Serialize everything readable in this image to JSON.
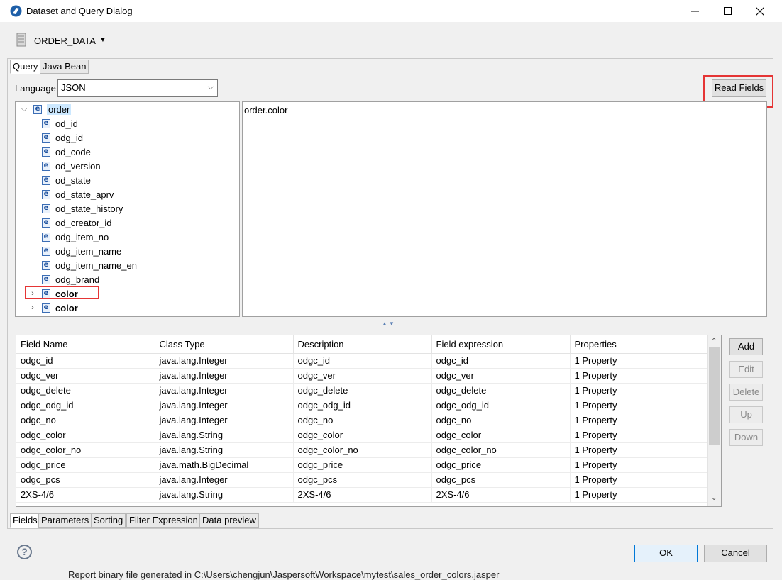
{
  "window": {
    "title": "Dataset and Query Dialog",
    "minimize_icon": "minimize-icon",
    "maximize_icon": "maximize-icon",
    "close_icon": "close-icon"
  },
  "dataset": {
    "name": "ORDER_DATA",
    "icon": "database-icon"
  },
  "top_tabs": [
    {
      "label": "Query",
      "active": true
    },
    {
      "label": "Java Bean",
      "active": false
    }
  ],
  "language": {
    "label": "Language",
    "value": "JSON"
  },
  "read_fields_label": "Read Fields",
  "tree": {
    "root": "order",
    "children": [
      "od_id",
      "odg_id",
      "od_code",
      "od_version",
      "od_state",
      "od_state_aprv",
      "od_state_history",
      "od_creator_id",
      "odg_item_no",
      "odg_item_name",
      "odg_item_name_en",
      "odg_brand"
    ],
    "collapsed": [
      "color",
      "color"
    ]
  },
  "expression": "order.color",
  "table": {
    "columns": [
      "Field Name",
      "Class Type",
      "Description",
      "Field expression",
      "Properties"
    ],
    "rows": [
      [
        "odgc_id",
        "java.lang.Integer",
        "odgc_id",
        "odgc_id",
        "1 Property"
      ],
      [
        "odgc_ver",
        "java.lang.Integer",
        "odgc_ver",
        "odgc_ver",
        "1 Property"
      ],
      [
        "odgc_delete",
        "java.lang.Integer",
        "odgc_delete",
        "odgc_delete",
        "1 Property"
      ],
      [
        "odgc_odg_id",
        "java.lang.Integer",
        "odgc_odg_id",
        "odgc_odg_id",
        "1 Property"
      ],
      [
        "odgc_no",
        "java.lang.Integer",
        "odgc_no",
        "odgc_no",
        "1 Property"
      ],
      [
        "odgc_color",
        "java.lang.String",
        "odgc_color",
        "odgc_color",
        "1 Property"
      ],
      [
        "odgc_color_no",
        "java.lang.String",
        "odgc_color_no",
        "odgc_color_no",
        "1 Property"
      ],
      [
        "odgc_price",
        "java.math.BigDecimal",
        "odgc_price",
        "odgc_price",
        "1 Property"
      ],
      [
        "odgc_pcs",
        "java.lang.Integer",
        "odgc_pcs",
        "odgc_pcs",
        "1 Property"
      ],
      [
        "2XS-4/6",
        "java.lang.String",
        "2XS-4/6",
        "2XS-4/6",
        "1 Property"
      ]
    ]
  },
  "side_buttons": {
    "add": "Add",
    "edit": "Edit",
    "delete": "Delete",
    "up": "Up",
    "down": "Down"
  },
  "bottom_tabs": [
    "Fields",
    "Parameters",
    "Sorting",
    "Filter Expression",
    "Data preview"
  ],
  "ok_label": "OK",
  "cancel_label": "Cancel",
  "help_icon": "help-icon",
  "status_text": "Report binary file generated in C:\\Users\\chengjun\\JaspersoftWorkspace\\mytest\\sales_order_colors.jasper"
}
